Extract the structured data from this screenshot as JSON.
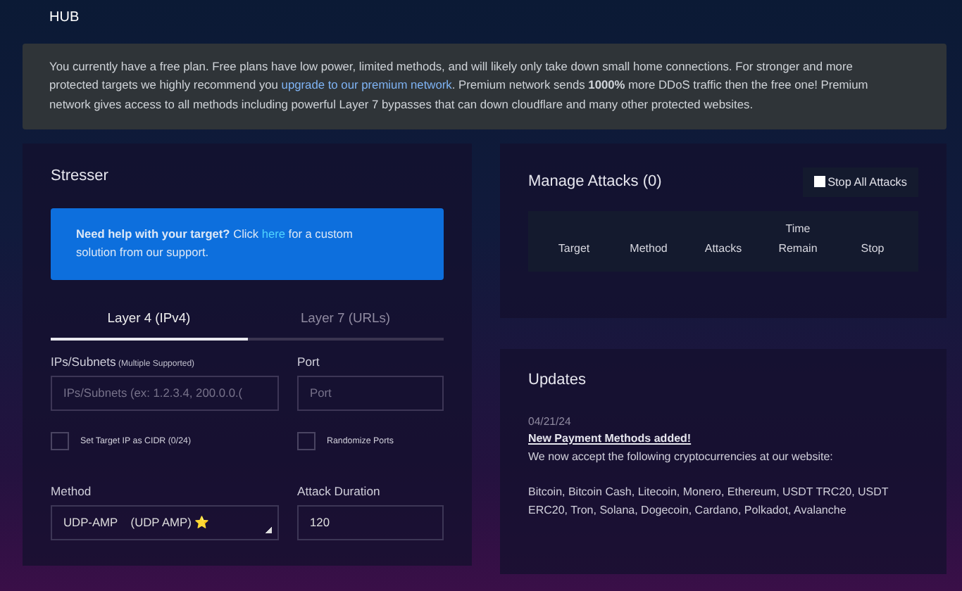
{
  "header": {
    "title": "HUB"
  },
  "notice": {
    "before": "You currently have a free plan. Free plans have low power, limited methods, and will likely only take down small home connections. For stronger and more protected targets we highly recommend you",
    "link": "upgrade to our premium network",
    "after": ". Premium network sends **1000%** more DDoS traffic then the free one! Premium network gives access to all methods including powerful Layer 7 bypasses that can down cloudflare and many other protected websites."
  },
  "stresser": {
    "title": "Stresser",
    "help": {
      "before": "**Need help with your target?** Click",
      "link": "here",
      "after": "for a custom solution from our support."
    },
    "tabs": [
      {
        "label": "Layer 4 (IPv4)",
        "selected": true
      },
      {
        "label": "Layer 7 (URLs)",
        "selected": false
      }
    ],
    "fields": [
      {
        "label": "IPs/Subnets",
        "note": "(Multiple Supported)",
        "placeholder": "IPs/Subnets (ex: 1.2.3.4, 200.0.0.(",
        "kind": "input"
      },
      {
        "label": "Port",
        "placeholder": "Port",
        "kind": "input"
      },
      {
        "label": "Set Target IP as CIDR (0/24)",
        "checked": false,
        "kind": "checkbox"
      },
      {
        "label": "Randomize Ports",
        "checked": false,
        "kind": "checkbox"
      },
      {
        "label": "Method",
        "value": "UDP-AMP    (UDP AMP) ⭐",
        "kind": "select"
      },
      {
        "label": "Attack Duration",
        "value": "120",
        "kind": "input"
      }
    ]
  },
  "manage": {
    "title": "Manage Attacks (0)",
    "stop_all": {
      "label": "Stop All Attacks",
      "checked": false
    },
    "columns": [
      "Target",
      "Method",
      "Attacks",
      "Time Remain",
      "Stop"
    ]
  },
  "updates": {
    "title": "Updates",
    "items": [
      {
        "date": "04/21/24",
        "headline": "New Payment Methods added!",
        "body": [
          "We now accept the following cryptocurrencies at our website:",
          "Bitcoin, Bitcoin Cash, Litecoin, Monero, Ethereum, USDT TRC20, USDT ERC20, Tron, Solana, Dogecoin, Cardano, Polkadot, Avalanche"
        ]
      }
    ]
  }
}
